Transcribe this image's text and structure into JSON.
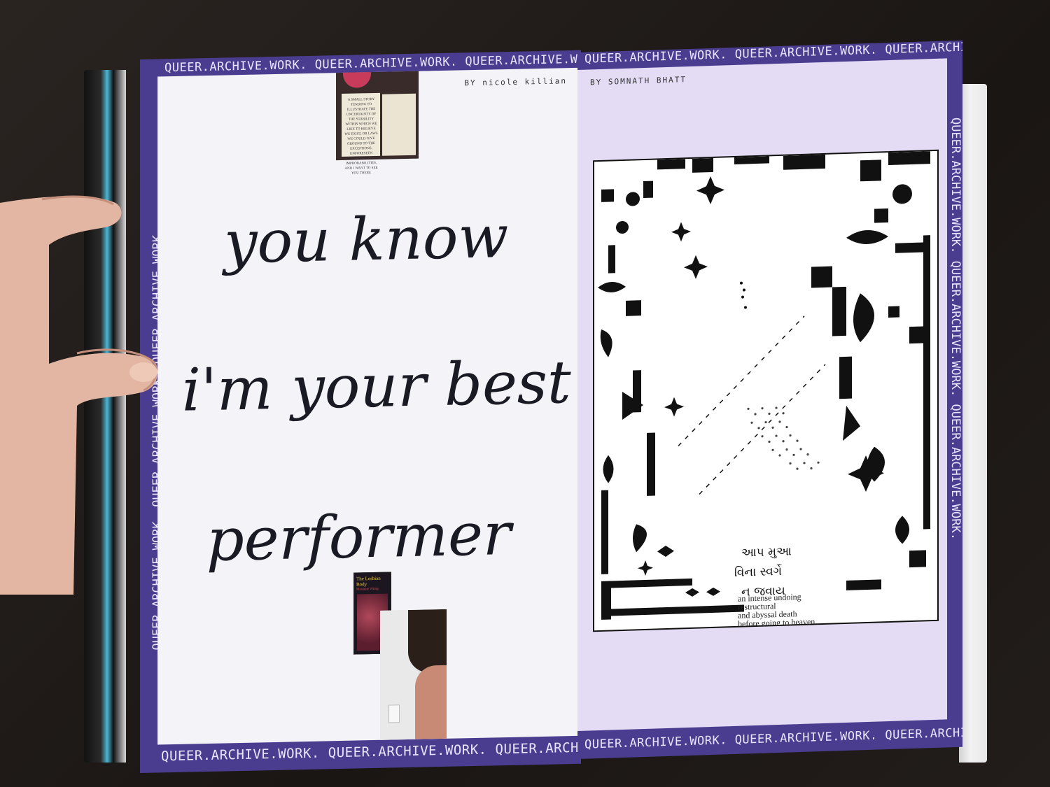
{
  "running_band": "QUEER.ARCHIVE.WORK. QUEER.ARCHIVE.WORK. QUEER.ARCHIVE.WORK.",
  "left_page": {
    "byline": "BY nicole killian",
    "headline": [
      "you know",
      "i'm your best",
      "performer"
    ],
    "book_excerpt": "A SMALL STORY TENDING TO ILLUSTRATE THE UNCERTAINTY OF THE STABILITY WITHIN WHICH WE LIKE TO BELIEVE WE EXIST, OR LAWS WE COULD GIVE GROUND TO THE EXCEPTIONS, UNFORESEEN DISASTERS, OR IMPROBABILITIES, AND I WANT TO SEE YOU THERE",
    "book_cover_title": "The Lesbian Body",
    "book_cover_author": "Monique Wittig"
  },
  "right_page": {
    "byline": "BY SOMNATH BHATT",
    "gujarati_lines": [
      "આપ મુઆ",
      "વિના સ્વર્ગે",
      "ન જવાય"
    ],
    "caption_lines": [
      "an intense undoing",
      "restructural",
      "and    abyssal death",
      "before going to heaven."
    ]
  },
  "colors": {
    "band": "#4a3d8f",
    "left_paper": "#f4f3f8",
    "right_paper": "#e4dcf4",
    "ink": "#1a1a24"
  }
}
